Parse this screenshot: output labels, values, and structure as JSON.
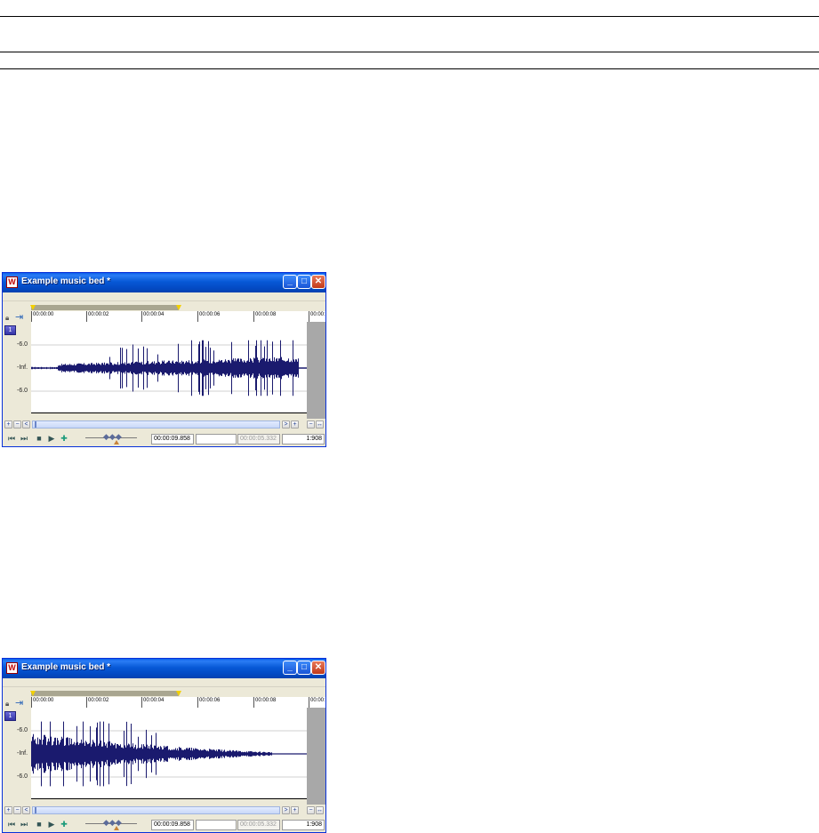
{
  "windows": [
    {
      "title": "Example music bed *",
      "ruler_labels": [
        "00:00:00",
        "00:00:02",
        "00:00:04",
        "00:00:06",
        "00:00:08",
        "00:00:"
      ],
      "db_labels": [
        "-6.0",
        "-Inf.",
        "-6.0"
      ],
      "channel_label": "1",
      "position": "00:00:09.858",
      "selection_length": "",
      "length": "00:00:05.332",
      "zoom": "1:908",
      "waveform_shape": "fade-in"
    },
    {
      "title": "Example music bed *",
      "ruler_labels": [
        "00:00:00",
        "00:00:02",
        "00:00:04",
        "00:00:06",
        "00:00:08",
        "00:00:"
      ],
      "db_labels": [
        "-6.0",
        "-Inf.",
        "-6.0"
      ],
      "channel_label": "1",
      "position": "00:00:09.858",
      "selection_length": "",
      "length": "00:00:05.332",
      "zoom": "1:908",
      "waveform_shape": "fade-out"
    }
  ],
  "icons": {
    "app": "sound-forge-icon",
    "minimize": "minimize-icon",
    "maximize": "maximize-icon",
    "close": "close-icon",
    "lock": "lock-icon",
    "snap": "snap-icon",
    "go_start": "go-to-start-icon",
    "go_end": "go-to-end-icon",
    "stop": "stop-icon",
    "play": "play-icon",
    "play_all": "play-all-icon"
  },
  "colors": {
    "titlebar": "#0758d6",
    "waveform": "#1a1a6e",
    "selection": "#a9a690",
    "marker": "#f2d000"
  }
}
